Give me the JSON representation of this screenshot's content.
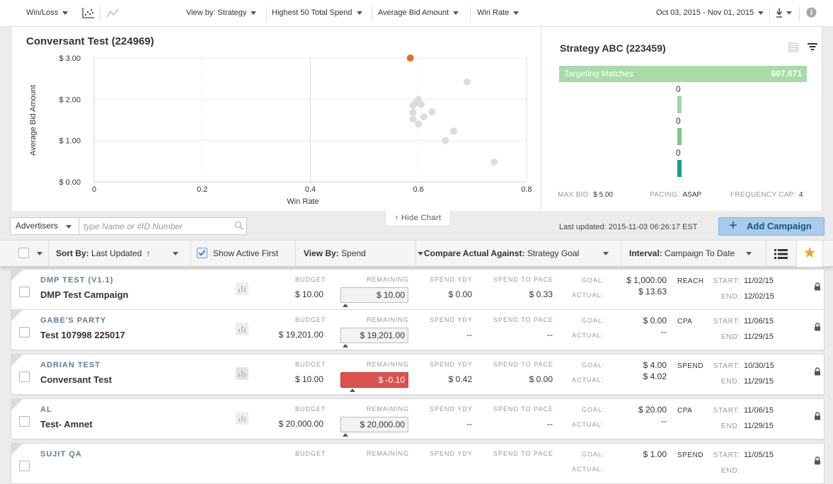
{
  "toolbar": {
    "chart_type": "Win/Loss",
    "view_by": "View by: Strategy",
    "highest": "Highest 50 Total Spend",
    "y_metric": "Average Bid Amount",
    "x_metric": "Win Rate",
    "date_range": "Oct 03, 2015 - Nov 01, 2015"
  },
  "chart": {
    "title": "Conversant Test (224969)",
    "hide_label": "Hide Chart",
    "chart_data": {
      "type": "scatter",
      "xlabel": "Win Rate",
      "ylabel": "Average Bid Amount",
      "xlim": [
        0,
        0.8
      ],
      "ylim": [
        0,
        3
      ],
      "x_ticks": [
        "0",
        "0.2",
        "0.4",
        "0.6",
        "0.8"
      ],
      "y_ticks": [
        "$ 0.00",
        "$ 1.00",
        "$ 2.00",
        "$ 3.00"
      ],
      "highlight_color": "#e0712a",
      "point_color": "#dcdcdc",
      "highlight": {
        "x": 0.585,
        "y": 3.0
      },
      "points": [
        {
          "x": 0.69,
          "y": 2.42
        },
        {
          "x": 0.6,
          "y": 2.0
        },
        {
          "x": 0.595,
          "y": 1.92
        },
        {
          "x": 0.605,
          "y": 1.88
        },
        {
          "x": 0.59,
          "y": 1.85
        },
        {
          "x": 0.625,
          "y": 1.7
        },
        {
          "x": 0.59,
          "y": 1.68
        },
        {
          "x": 0.61,
          "y": 1.58
        },
        {
          "x": 0.59,
          "y": 1.52
        },
        {
          "x": 0.6,
          "y": 1.4
        },
        {
          "x": 0.665,
          "y": 1.23
        },
        {
          "x": 0.65,
          "y": 1.0
        },
        {
          "x": 0.74,
          "y": 0.48
        }
      ]
    }
  },
  "strategy": {
    "title": "Strategy ABC (223459)",
    "targeting_label": "Targeting Matches",
    "targeting_value": "607,671",
    "funnel_values": [
      "0",
      "0",
      "0"
    ],
    "funnel_colors": [
      "#9fd6a3",
      "#7fc48a",
      "#12a087"
    ],
    "max_bid_label": "MAX BID:",
    "max_bid": "$ 5.00",
    "pacing_label": "PACING:",
    "pacing": "ASAP",
    "frequency_label": "FREQUENCY CAP:",
    "frequency": "4"
  },
  "filter": {
    "advertisers": "Advertisers",
    "search_placeholder": "type Name or #ID Number",
    "last_updated": "Last updated: 2015-11-03 06:26:17 EST",
    "add_campaign": "Add Campaign"
  },
  "sortbar": {
    "sort_label": "Sort By:",
    "sort_value": "Last Updated",
    "show_active": "Show Active First",
    "view_label": "View By:",
    "view_value": "Spend",
    "compare_label": "Compare Actual Against:",
    "compare_value": "Strategy Goal",
    "interval_label": "Interval:",
    "interval_value": "Campaign To Date"
  },
  "columns": {
    "budget": "BUDGET",
    "remaining": "REMAINING",
    "spend_ydy": "SPEND YDY",
    "spend_to_pace": "SPEND TO PACE",
    "goal": "GOAL:",
    "actual": "ACTUAL:",
    "start": "START:",
    "end": "END:"
  },
  "campaigns": [
    {
      "advertiser": "DMP TEST (V1.1)",
      "name": "DMP Test Campaign",
      "budget": "$ 10.00",
      "remaining": "$ 10.00",
      "spend_ydy": "$ 0.00",
      "spend_to_pace": "$ 0.33",
      "goal": "$ 1,000.00",
      "actual": "$ 13.63",
      "goal_type": "REACH",
      "start": "11/02/15",
      "end": "12/02/15"
    },
    {
      "advertiser": "GABE'S PARTY",
      "name": "Test 107998 225017",
      "budget": "$ 19,201.00",
      "remaining": "$ 19,201.00",
      "spend_ydy": "--",
      "spend_to_pace": "--",
      "goal": "$ 0.00",
      "actual": "--",
      "goal_type": "CPA",
      "start": "11/06/15",
      "end": "11/29/15"
    },
    {
      "advertiser": "ADRIAN TEST",
      "name": "Conversant Test",
      "budget": "$ 10.00",
      "remaining": "$ -0.10",
      "spend_ydy": "$ 0.42",
      "spend_to_pace": "$ 0.00",
      "goal": "$ 4.00",
      "actual": "$ 4.02",
      "goal_type": "SPEND",
      "start": "10/30/15",
      "end": "11/29/15"
    },
    {
      "advertiser": "AL",
      "name": "Test- Amnet",
      "budget": "$ 20,000.00",
      "remaining": "$ 20,000.00",
      "spend_ydy": "--",
      "spend_to_pace": "--",
      "goal": "$ 20.00",
      "actual": "--",
      "goal_type": "CPA",
      "start": "11/06/15",
      "end": "11/29/15"
    },
    {
      "advertiser": "SUJIT QA",
      "name": "",
      "budget": "",
      "remaining": "",
      "spend_ydy": "",
      "spend_to_pace": "",
      "goal": "$ 1.00",
      "actual": "",
      "goal_type": "SPEND",
      "start": "11/05/15",
      "end": ""
    }
  ]
}
